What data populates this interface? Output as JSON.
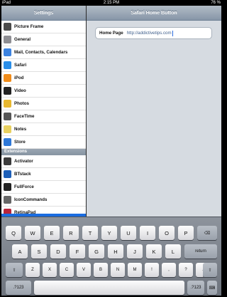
{
  "status_bar": {
    "device": "iPad",
    "time": "2:15 PM",
    "battery": "76 %"
  },
  "master": {
    "title": "Settings",
    "items_top": [
      {
        "label": "Picture Frame",
        "icon": "picture-frame-icon",
        "color": "#4a4a4a"
      },
      {
        "label": "General",
        "icon": "gear-icon",
        "color": "#8e8e93"
      },
      {
        "label": "Mail, Contacts, Calendars",
        "icon": "mail-icon",
        "color": "#3b82e0"
      },
      {
        "label": "Safari",
        "icon": "compass-icon",
        "color": "#2a8ee8"
      },
      {
        "label": "iPod",
        "icon": "ipod-icon",
        "color": "#f08c1a"
      },
      {
        "label": "Video",
        "icon": "video-icon",
        "color": "#222222"
      },
      {
        "label": "Photos",
        "icon": "sunflower-icon",
        "color": "#e8b830"
      },
      {
        "label": "FaceTime",
        "icon": "facetime-icon",
        "color": "#555555"
      },
      {
        "label": "Notes",
        "icon": "notes-icon",
        "color": "#e8d060"
      },
      {
        "label": "Store",
        "icon": "store-icon",
        "color": "#2e78d8"
      }
    ],
    "section_header": "Extensions",
    "items_ext": [
      {
        "label": "Activator",
        "icon": "activator-icon",
        "color": "#3b3b3b"
      },
      {
        "label": "BTstack",
        "icon": "bluetooth-icon",
        "color": "#1d5fb8"
      },
      {
        "label": "FullForce",
        "icon": "fullforce-icon",
        "color": "#222222"
      },
      {
        "label": "IconCommands",
        "icon": "iconcommands-icon",
        "color": "#666666"
      },
      {
        "label": "RetinaPad",
        "icon": "retinapad-icon",
        "color": "#b8243a"
      }
    ]
  },
  "detail": {
    "title": "Safari Home Button",
    "field_label": "Home Page",
    "field_value": "http://addictivetips.com"
  },
  "keyboard": {
    "row1": [
      "Q",
      "W",
      "E",
      "R",
      "T",
      "Y",
      "U",
      "I",
      "O",
      "P"
    ],
    "row2": [
      "A",
      "S",
      "D",
      "F",
      "G",
      "H",
      "J",
      "K",
      "L"
    ],
    "return_label": "return",
    "row3": [
      "Z",
      "X",
      "C",
      "V",
      "B",
      "N",
      "M",
      "!",
      ",",
      "?",
      "."
    ],
    "num_label": ".?123"
  }
}
